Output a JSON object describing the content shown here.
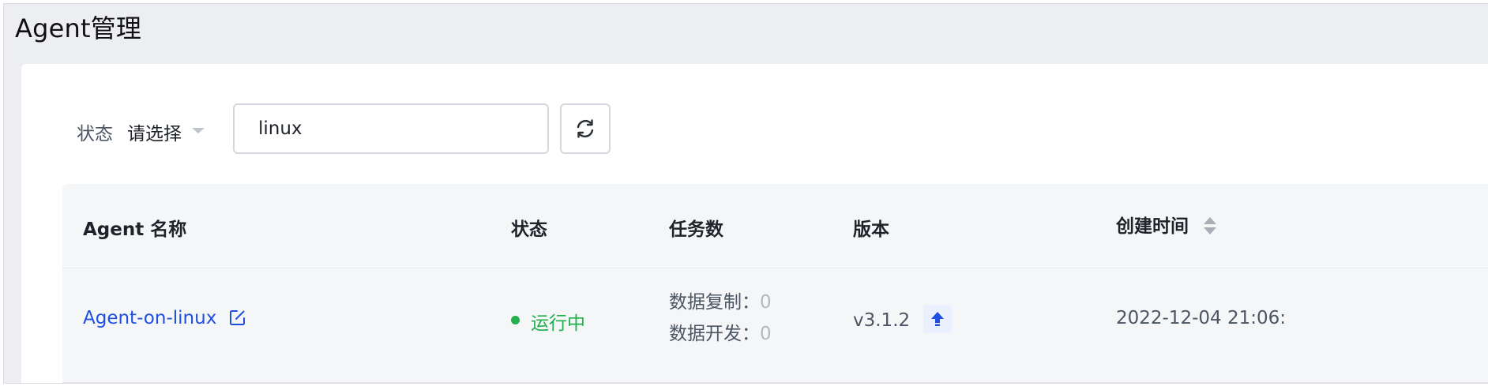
{
  "page": {
    "title": "Agent管理"
  },
  "filters": {
    "status_label": "状态",
    "status_select_value": "请选择",
    "search_value": "linux",
    "refresh_icon": "refresh-icon"
  },
  "table": {
    "columns": [
      {
        "key": "name",
        "label": "Agent 名称"
      },
      {
        "key": "status",
        "label": "状态"
      },
      {
        "key": "tasks",
        "label": "任务数"
      },
      {
        "key": "version",
        "label": "版本"
      },
      {
        "key": "created",
        "label": "创建时间",
        "sortable": true
      }
    ],
    "rows": [
      {
        "name": "Agent-on-linux",
        "status": "运行中",
        "status_color": "#21b04b",
        "tasks": [
          {
            "label": "数据复制：",
            "count": "0"
          },
          {
            "label": "数据开发：",
            "count": "0"
          }
        ],
        "version": "v3.1.2",
        "created": "2022-12-04 21:06:"
      }
    ]
  },
  "colors": {
    "link": "#1f4fe0",
    "running": "#21b04b",
    "upgrade_icon": "#1f4fe0",
    "header_bg": "#eceef2",
    "table_bg": "#f5f6f8"
  },
  "icons": {
    "edit": "edit-icon",
    "upgrade": "arrow-up-icon",
    "sort": "sort-icon",
    "select_caret": "caret-down-icon"
  }
}
